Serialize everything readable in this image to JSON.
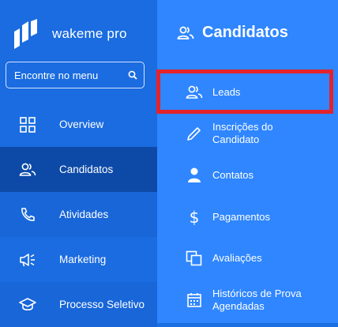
{
  "brand": {
    "name": "wakeme pro"
  },
  "search": {
    "placeholder": "Encontre no menu",
    "icon": "search-icon"
  },
  "sidebar": {
    "items": [
      {
        "label": "Overview",
        "icon": "grid-icon"
      },
      {
        "label": "Candidatos",
        "icon": "users-icon",
        "active": true
      },
      {
        "label": "Atividades",
        "icon": "phone-icon"
      },
      {
        "label": "Marketing",
        "icon": "megaphone-icon"
      },
      {
        "label": "Processo Seletivo",
        "icon": "graduation-cap-icon"
      }
    ]
  },
  "submenu": {
    "title": "Candidatos",
    "items": [
      {
        "label": "Leads",
        "icon": "users-icon",
        "highlighted": true
      },
      {
        "label": "Inscrições do Candidato",
        "icon": "pencil-icon"
      },
      {
        "label": "Contatos",
        "icon": "person-icon"
      },
      {
        "label": "Pagamentos",
        "icon": "dollar-icon"
      },
      {
        "label": "Avaliações",
        "icon": "copy-icon"
      },
      {
        "label": "Históricos de Prova Agendadas",
        "icon": "calendar-icon"
      }
    ]
  },
  "colors": {
    "sidebar": "#1a6ce0",
    "submenu": "#2f86ff",
    "active": "#0d4aa8",
    "highlight": "#e3232c"
  }
}
